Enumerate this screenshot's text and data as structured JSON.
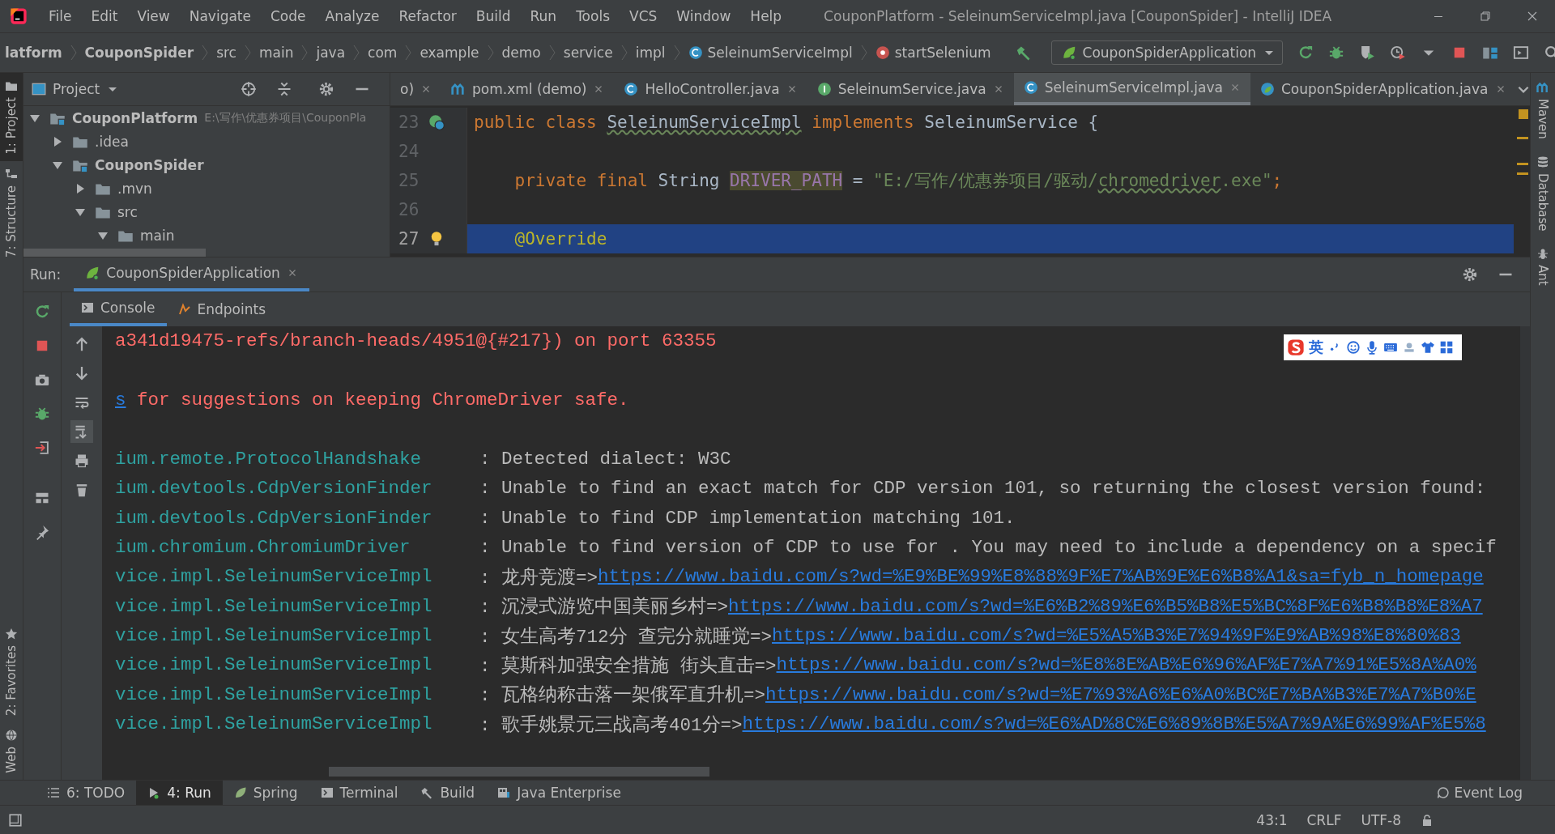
{
  "menu": [
    "File",
    "Edit",
    "View",
    "Navigate",
    "Code",
    "Analyze",
    "Refactor",
    "Build",
    "Run",
    "Tools",
    "VCS",
    "Window",
    "Help"
  ],
  "window_title": "CouponPlatform - SeleinumServiceImpl.java [CouponSpider] - IntelliJ IDEA",
  "breadcrumbs": [
    {
      "label": "latform",
      "kind": "folder",
      "bold": true
    },
    {
      "label": "CouponSpider",
      "kind": "folder",
      "bold": true
    },
    {
      "label": "src",
      "kind": "folder",
      "bold": false
    },
    {
      "label": "main",
      "kind": "folder",
      "bold": false
    },
    {
      "label": "java",
      "kind": "folder",
      "bold": false
    },
    {
      "label": "com",
      "kind": "folder",
      "bold": false
    },
    {
      "label": "example",
      "kind": "folder",
      "bold": false
    },
    {
      "label": "demo",
      "kind": "folder",
      "bold": false
    },
    {
      "label": "service",
      "kind": "folder",
      "bold": false
    },
    {
      "label": "impl",
      "kind": "folder",
      "bold": false
    },
    {
      "label": "SeleinumServiceImpl",
      "kind": "class",
      "bold": false
    },
    {
      "label": "startSelenium",
      "kind": "method",
      "bold": false
    }
  ],
  "run_config": "CouponSpiderApplication",
  "left_strip": [
    {
      "label": "1: Project",
      "selected": true
    },
    {
      "label": "7: Structure",
      "selected": false
    },
    {
      "label": "2: Favorites",
      "selected": false
    },
    {
      "label": "Web",
      "selected": false
    }
  ],
  "right_strip": [
    "Maven",
    "Database",
    "Ant"
  ],
  "project_panel": {
    "title": "Project",
    "tree": [
      {
        "label": "CouponPlatform",
        "path": "E:\\写作\\优惠券项目\\CouponPla",
        "kind": "module",
        "expanded": true,
        "children": [
          {
            "label": ".idea",
            "kind": "folder",
            "expanded": false
          },
          {
            "label": "CouponSpider",
            "kind": "module",
            "expanded": true,
            "children": [
              {
                "label": ".mvn",
                "kind": "folder",
                "expanded": false
              },
              {
                "label": "src",
                "kind": "folder",
                "expanded": true,
                "children": [
                  {
                    "label": "main",
                    "kind": "folder",
                    "expanded": true
                  }
                ]
              }
            ]
          }
        ]
      }
    ]
  },
  "editor_tabs": [
    {
      "label": "o)",
      "kind": "none",
      "selected": false
    },
    {
      "label": "pom.xml (demo)",
      "kind": "maven",
      "selected": false
    },
    {
      "label": "HelloController.java",
      "kind": "class",
      "selected": false
    },
    {
      "label": "SeleinumService.java",
      "kind": "interface",
      "selected": false
    },
    {
      "label": "SeleinumServiceImpl.java",
      "kind": "class",
      "selected": true
    },
    {
      "label": "CouponSpiderApplication.java",
      "kind": "spring",
      "selected": false
    }
  ],
  "code_lines": [
    {
      "number": "23",
      "current": false,
      "tokens": [
        {
          "text": "public class ",
          "kind": "keyword"
        },
        {
          "text": "SeleinumServiceImpl",
          "kind": "typo"
        },
        {
          "text": " implements ",
          "kind": "keyword"
        },
        {
          "text": "SeleinumService {",
          "kind": "plain"
        }
      ]
    },
    {
      "number": "24",
      "current": false
    },
    {
      "number": "25",
      "current": false,
      "tokens": [
        {
          "text": "    private final ",
          "kind": "keyword"
        },
        {
          "text": "String ",
          "kind": "plain"
        },
        {
          "text": "DRIVER_PATH",
          "kind": "field"
        },
        {
          "text": " = ",
          "kind": "plain"
        },
        {
          "text": "\"E:/写作/优惠券项目/驱动/",
          "kind": "string"
        },
        {
          "text": "chromedriver",
          "kind": "string_typo"
        },
        {
          "text": ".exe\"",
          "kind": "string"
        },
        {
          "text": ";",
          "kind": "keyword"
        }
      ]
    },
    {
      "number": "26",
      "current": false
    },
    {
      "number": "27",
      "current": true,
      "tokens": [
        {
          "text": "    @Override",
          "kind": "annotation"
        }
      ]
    }
  ],
  "run_panel": {
    "label": "Run:",
    "tab": "CouponSpiderApplication",
    "subtabs": [
      {
        "label": "Console",
        "kind": "console",
        "selected": true
      },
      {
        "label": "Endpoints",
        "kind": "endpoints",
        "selected": false
      }
    ],
    "lines": [
      {
        "kind": "error",
        "text": "a341d19475-refs/branch-heads/4951@{#217}) on port 63355"
      },
      {
        "kind": "gap"
      },
      {
        "kind": "error_link",
        "link": "s",
        "text": " for suggestions on keeping ChromeDriver safe."
      },
      {
        "kind": "gap"
      },
      {
        "kind": "log",
        "logger": "ium.remote.ProtocolHandshake",
        "message": ": Detected dialect: W3C"
      },
      {
        "kind": "log",
        "logger": "ium.devtools.CdpVersionFinder",
        "message": ": Unable to find an exact match for CDP version 101, so returning the closest version found:"
      },
      {
        "kind": "log",
        "logger": "ium.devtools.CdpVersionFinder",
        "message": ": Unable to find CDP implementation matching 101."
      },
      {
        "kind": "log",
        "logger": "ium.chromium.ChromiumDriver",
        "message": ": Unable to find version of CDP to use for . You may need to include a dependency on a specif"
      },
      {
        "kind": "log",
        "logger": "vice.impl.SeleinumServiceImpl",
        "message": ": 龙舟竞渡=>",
        "link": "https://www.baidu.com/s?wd=%E9%BE%99%E8%88%9F%E7%AB%9E%E6%B8%A1&sa=fyb_n_homepage"
      },
      {
        "kind": "log",
        "logger": "vice.impl.SeleinumServiceImpl",
        "message": ": 沉浸式游览中国美丽乡村=>",
        "link": "https://www.baidu.com/s?wd=%E6%B2%89%E6%B5%B8%E5%BC%8F%E6%B8%B8%E8%A7"
      },
      {
        "kind": "log",
        "logger": "vice.impl.SeleinumServiceImpl",
        "message": ": 女生高考712分 查完分就睡觉=>",
        "link": "https://www.baidu.com/s?wd=%E5%A5%B3%E7%94%9F%E9%AB%98%E8%80%83"
      },
      {
        "kind": "log",
        "logger": "vice.impl.SeleinumServiceImpl",
        "message": ": 莫斯科加强安全措施 街头直击=>",
        "link": "https://www.baidu.com/s?wd=%E8%8E%AB%E6%96%AF%E7%A7%91%E5%8A%A0%"
      },
      {
        "kind": "log",
        "logger": "vice.impl.SeleinumServiceImpl",
        "message": ": 瓦格纳称击落一架俄军直升机=>",
        "link": "https://www.baidu.com/s?wd=%E7%93%A6%E6%A0%BC%E7%BA%B3%E7%A7%B0%E"
      },
      {
        "kind": "log",
        "logger": "vice.impl.SeleinumServiceImpl",
        "message": ": 歌手姚景元三战高考401分=>",
        "link": "https://www.baidu.com/s?wd=%E6%AD%8C%E6%89%8B%E5%A7%9A%E6%99%AF%E5%8"
      }
    ]
  },
  "ime_toolbar": {
    "mode": "英"
  },
  "bottom_tabs": [
    {
      "label": "6: TODO",
      "kind": "list",
      "selected": false
    },
    {
      "label": "4: Run",
      "kind": "run",
      "selected": true
    },
    {
      "label": "Spring",
      "kind": "spring",
      "selected": false
    },
    {
      "label": "Terminal",
      "kind": "terminal",
      "selected": false
    },
    {
      "label": "Build",
      "kind": "build",
      "selected": false
    },
    {
      "label": "Java Enterprise",
      "kind": "enterprise",
      "selected": false
    }
  ],
  "event_log": "Event Log",
  "status": [
    "43:1",
    "CRLF",
    "UTF-8"
  ]
}
